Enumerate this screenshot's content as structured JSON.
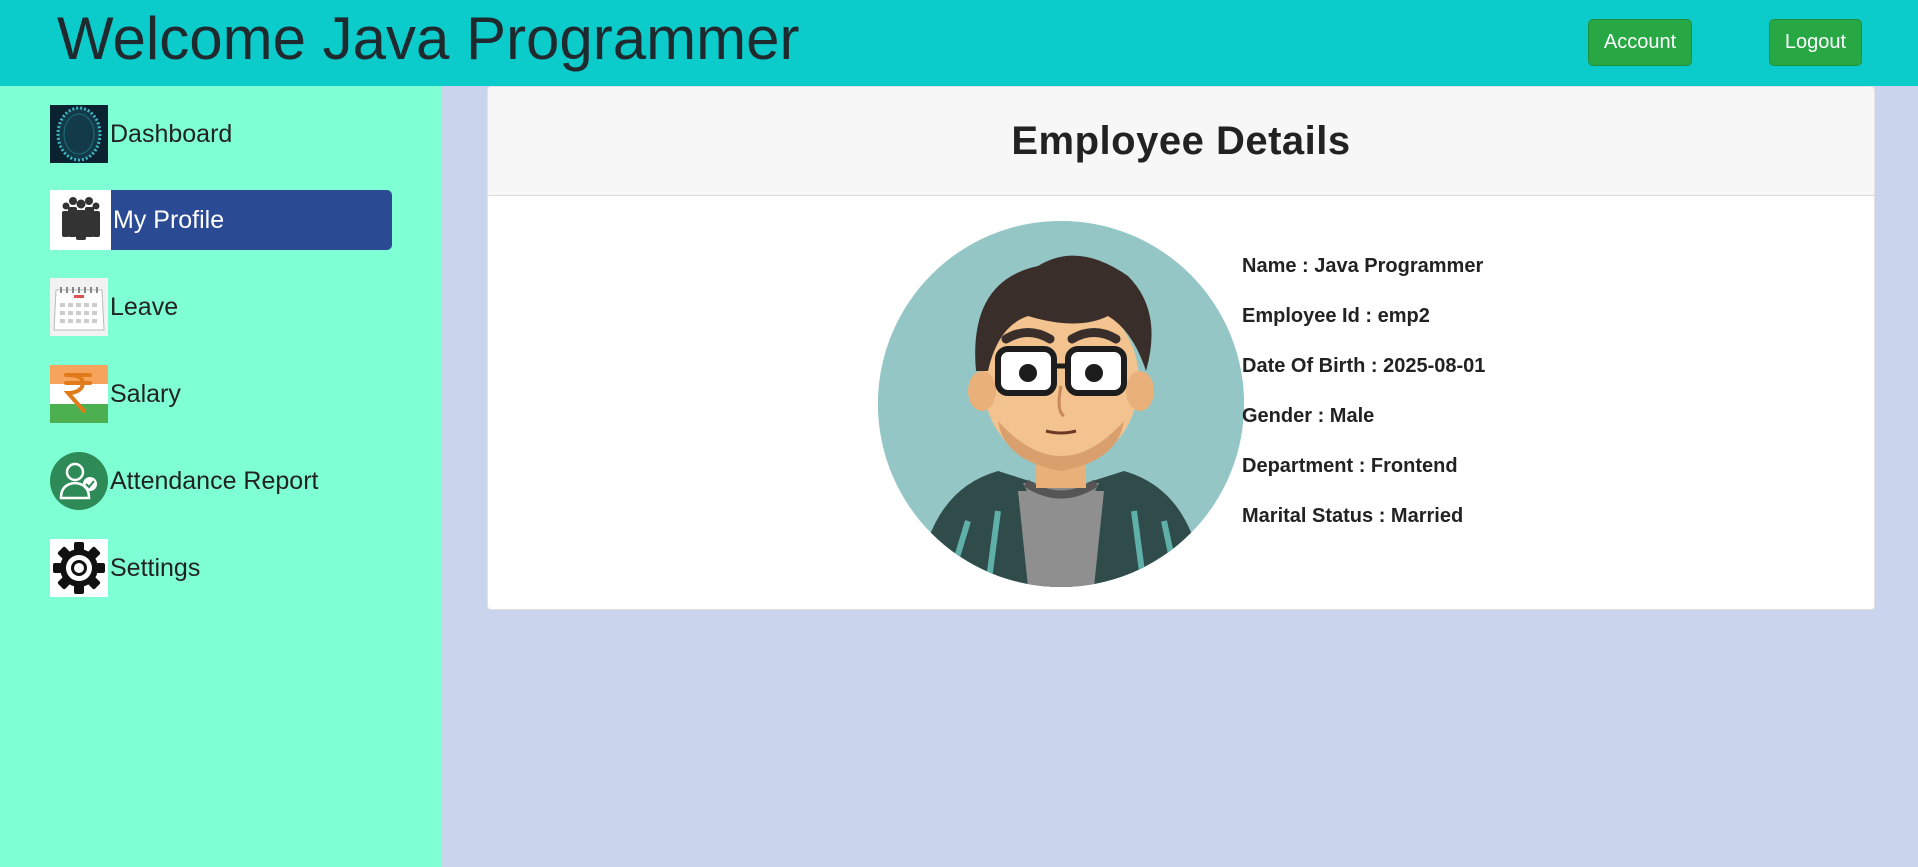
{
  "header": {
    "title": "Welcome Java Programmer",
    "account_label": "Account",
    "logout_label": "Logout"
  },
  "sidebar": {
    "items": [
      {
        "label": "Dashboard",
        "icon": "dashboard-icon"
      },
      {
        "label": "My Profile",
        "icon": "team-icon",
        "active": true
      },
      {
        "label": "Leave",
        "icon": "calendar-icon"
      },
      {
        "label": "Salary",
        "icon": "rupee-icon"
      },
      {
        "label": "Attendance Report",
        "icon": "attendance-user-icon"
      },
      {
        "label": "Settings",
        "icon": "gear-icon"
      }
    ]
  },
  "card": {
    "title": "Employee Details",
    "details": [
      "Name : Java Programmer",
      "Employee Id : emp2",
      "Date Of Birth : 2025-08-01",
      "Gender : Male",
      "Department : Frontend",
      "Marital Status : Married"
    ]
  },
  "colors": {
    "topbar": "#0bcbcb",
    "sidebar": "#7fffd4",
    "active_nav": "#2b4a94",
    "button_green": "#28a745",
    "page_bg": "#cad4ec"
  }
}
